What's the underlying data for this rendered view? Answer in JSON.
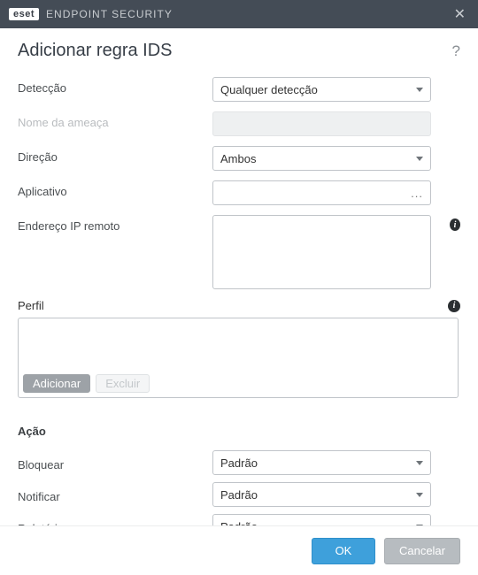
{
  "titlebar": {
    "logo": "eset",
    "title": "ENDPOINT SECURITY"
  },
  "heading": "Adicionar regra IDS",
  "form": {
    "deteccao": {
      "label": "Detecção",
      "value": "Qualquer detecção"
    },
    "nome_ameaca": {
      "label": "Nome da ameaça",
      "value": ""
    },
    "direcao": {
      "label": "Direção",
      "value": "Ambos"
    },
    "aplicativo": {
      "label": "Aplicativo",
      "value": ""
    },
    "endereco_ip": {
      "label": "Endereço IP remoto",
      "value": ""
    }
  },
  "perfil": {
    "label": "Perfil",
    "add": "Adicionar",
    "del": "Excluir",
    "value": ""
  },
  "acao": {
    "section": "Ação",
    "bloquear": {
      "label": "Bloquear",
      "value": "Padrão"
    },
    "notificar": {
      "label": "Notificar",
      "value": "Padrão"
    },
    "relatorio": {
      "label": "Relatório",
      "value": "Padrão"
    }
  },
  "footer": {
    "ok": "OK",
    "cancel": "Cancelar"
  }
}
